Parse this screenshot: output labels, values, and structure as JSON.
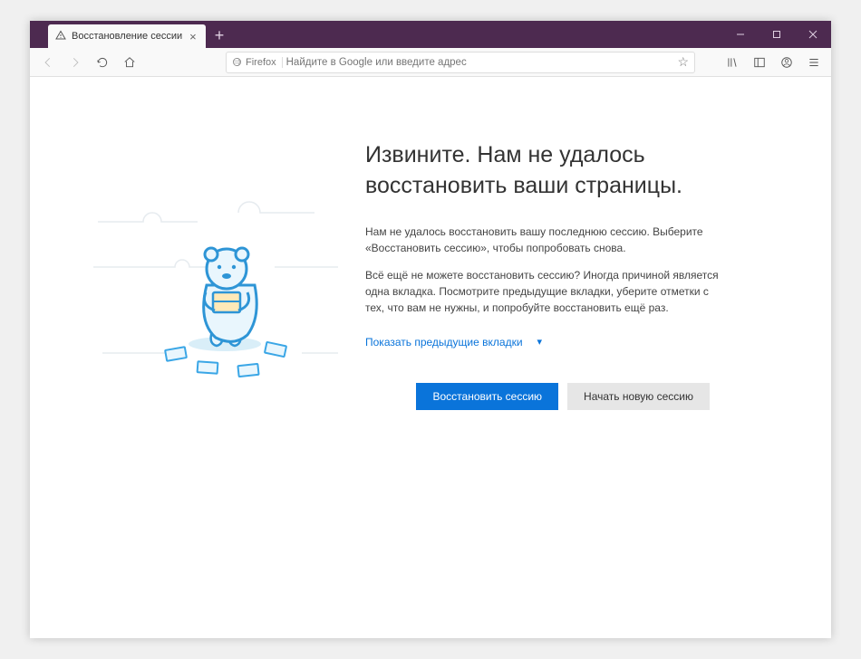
{
  "tab": {
    "title": "Восстановление сессии"
  },
  "urlbar": {
    "prefix": "Firefox",
    "placeholder": "Найдите в Google или введите адрес"
  },
  "page": {
    "heading": "Извините. Нам не удалось восстановить ваши страницы.",
    "para1": "Нам не удалось восстановить вашу последнюю сессию. Выберите «Восстановить сессию», чтобы попробовать снова.",
    "para2": "Всё ещё не можете восстановить сессию? Иногда причиной является одна вкладка. Посмотрите предыдущие вкладки, уберите отметки с тех, что вам не нужны, и попробуйте восстановить ещё раз.",
    "show_tabs": "Показать предыдущие вкладки",
    "restore_button": "Восстановить сессию",
    "new_session_button": "Начать новую сессию"
  }
}
